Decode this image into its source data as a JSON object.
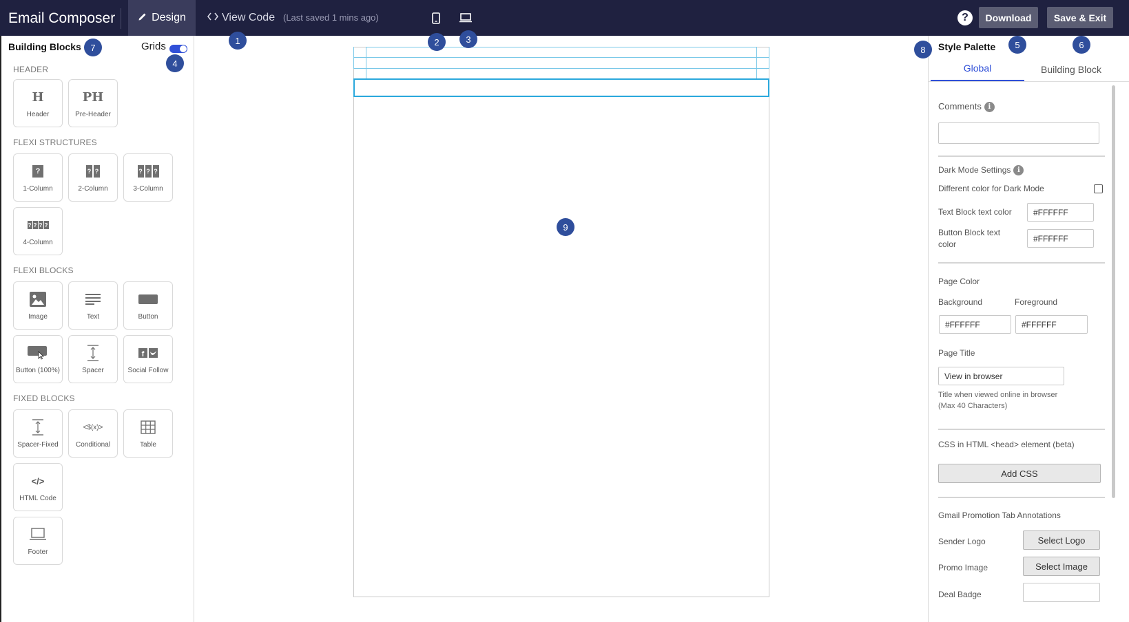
{
  "topbar": {
    "app_title": "Email Composer",
    "design_label": "Design",
    "view_code_label": "View Code",
    "last_saved": "(Last saved 1 mins ago)",
    "download_label": "Download",
    "save_exit_label": "Save & Exit",
    "help_glyph": "?"
  },
  "badges": [
    "1",
    "2",
    "3",
    "4",
    "5",
    "6",
    "7",
    "8",
    "9"
  ],
  "left_panel": {
    "title": "Building Blocks",
    "grids_label": "Grids",
    "grids_on": true,
    "sections": {
      "header": "HEADER",
      "flexi_structures": "FLEXI STRUCTURES",
      "flexi_blocks": "FLEXI BLOCKS",
      "fixed_blocks": "FIXED BLOCKS"
    },
    "blocks": {
      "header": {
        "glyph": "H",
        "label": "Header"
      },
      "pre_header": {
        "glyph": "PH",
        "label": "Pre-Header"
      },
      "col1": {
        "label": "1-Column"
      },
      "col2": {
        "label": "2-Column"
      },
      "col3": {
        "label": "3-Column"
      },
      "col4": {
        "label": "4-Column"
      },
      "image": {
        "label": "Image"
      },
      "text": {
        "label": "Text"
      },
      "button": {
        "label": "Button"
      },
      "button_full": {
        "label": "Button (100%)"
      },
      "spacer": {
        "label": "Spacer"
      },
      "social_follow": {
        "label": "Social Follow"
      },
      "spacer_fixed": {
        "label": "Spacer-Fixed"
      },
      "conditional": {
        "glyph": "<$(x)>",
        "label": "Conditional"
      },
      "table": {
        "label": "Table"
      },
      "html_code": {
        "glyph": "</>",
        "label": "HTML Code"
      },
      "footer": {
        "label": "Footer"
      }
    },
    "qmark": "?"
  },
  "right_panel": {
    "title": "Style Palette",
    "tabs": [
      "Global",
      "Building Block"
    ],
    "active_tab": "Global",
    "comments_label": "Comments",
    "comments_value": "",
    "dark_mode_title": "Dark Mode Settings",
    "diff_color_label": "Different color for Dark Mode",
    "diff_color_checked": false,
    "text_block_color_label": "Text Block text color",
    "text_block_color_value": "#FFFFFF",
    "button_block_color_label": "Button Block text color",
    "button_block_color_value": "#FFFFFF",
    "page_color_title": "Page Color",
    "background_label": "Background",
    "foreground_label": "Foreground",
    "background_value": "#FFFFFF",
    "foreground_value": "#FFFFFF",
    "page_title_label": "Page Title",
    "page_title_value": "View in browser",
    "page_title_hint_1": "Title when viewed online in browser",
    "page_title_hint_2": "(Max 40 Characters)",
    "css_label": "CSS in HTML <head> element (beta)",
    "add_css_label": "Add CSS",
    "gmail_title": "Gmail Promotion Tab Annotations",
    "sender_logo_label": "Sender Logo",
    "select_logo_label": "Select Logo",
    "promo_image_label": "Promo Image",
    "select_image_label": "Select Image",
    "deal_badge_label": "Deal Badge",
    "deal_badge_value": "",
    "info_glyph": "i"
  },
  "colors": {
    "topbar_bg": "#1f2140",
    "accent": "#3050d8",
    "badge": "#2f4e9c",
    "grid_line": "#79c8e8"
  }
}
